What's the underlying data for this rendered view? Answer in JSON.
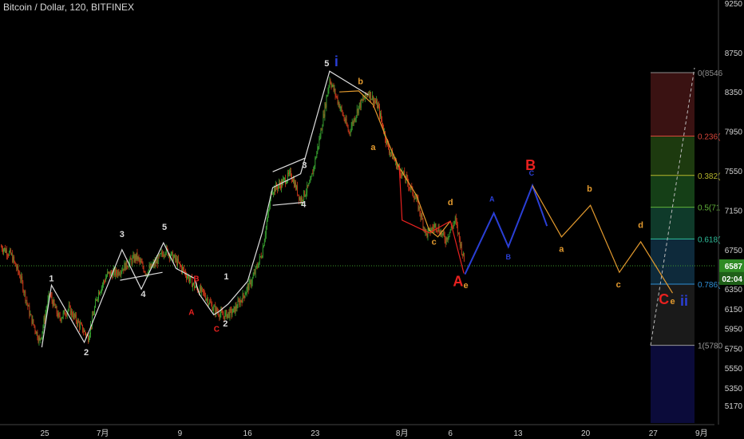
{
  "header": {
    "title": "Bitcoin / Dollar, 120, BITFINEX"
  },
  "colors": {
    "background": "#000000",
    "candle_up": "#3aa832",
    "candle_down": "#d03a1a",
    "wave_white": "#dddddd",
    "wave_orange": "#e39a2e",
    "wave_blue": "#2a3fd6",
    "wave_red": "#e8211f",
    "price_badge": "#2e8b24",
    "time_badge": "#1e5f18"
  },
  "chart_data": {
    "type": "candlestick",
    "symbol": "Bitcoin / Dollar",
    "interval": "120",
    "exchange": "BITFINEX",
    "y_axis": {
      "ticks": [
        9250,
        8750,
        8350,
        7950,
        7550,
        7150,
        6750,
        6350,
        6150,
        5950,
        5750,
        5550,
        5350,
        5170
      ],
      "range": [
        5050,
        9300
      ]
    },
    "x_axis": {
      "ticks": [
        {
          "label": "25",
          "day": 0
        },
        {
          "label": "7月",
          "day": 6
        },
        {
          "label": "9",
          "day": 14
        },
        {
          "label": "16",
          "day": 21
        },
        {
          "label": "23",
          "day": 28
        },
        {
          "label": "8月",
          "day": 37
        },
        {
          "label": "6",
          "day": 42
        },
        {
          "label": "13",
          "day": 49
        },
        {
          "label": "20",
          "day": 56
        },
        {
          "label": "27",
          "day": 63
        },
        {
          "label": "9月",
          "day": 68
        }
      ]
    },
    "current_price": {
      "value": 6587,
      "label": "6587",
      "countdown": "02:04"
    },
    "price_path": [
      [
        -4.5,
        6780
      ],
      [
        -3.5,
        6700
      ],
      [
        -2.5,
        6470
      ],
      [
        -1.5,
        6080
      ],
      [
        -0.5,
        5820
      ],
      [
        0.5,
        6300
      ],
      [
        1.5,
        6050
      ],
      [
        2.5,
        6150
      ],
      [
        3.5,
        6000
      ],
      [
        4.5,
        5860
      ],
      [
        5.5,
        6300
      ],
      [
        6.5,
        6500
      ],
      [
        7.5,
        6520
      ],
      [
        8.5,
        6600
      ],
      [
        9.5,
        6680
      ],
      [
        10.5,
        6520
      ],
      [
        11.5,
        6620
      ],
      [
        12.5,
        6750
      ],
      [
        13.5,
        6650
      ],
      [
        14.5,
        6520
      ],
      [
        15.5,
        6380
      ],
      [
        16.5,
        6300
      ],
      [
        17.5,
        6150
      ],
      [
        18.5,
        6080
      ],
      [
        19.5,
        6120
      ],
      [
        20.5,
        6270
      ],
      [
        21.5,
        6450
      ],
      [
        22.5,
        6720
      ],
      [
        23.5,
        7350
      ],
      [
        24.5,
        7420
      ],
      [
        25.5,
        7520
      ],
      [
        26.5,
        7250
      ],
      [
        27.5,
        7420
      ],
      [
        28.5,
        7900
      ],
      [
        29.5,
        8480
      ],
      [
        30.5,
        8220
      ],
      [
        31.5,
        7940
      ],
      [
        32.5,
        8200
      ],
      [
        33.5,
        8350
      ],
      [
        34.5,
        8200
      ],
      [
        35.5,
        7800
      ],
      [
        36.5,
        7600
      ],
      [
        37.5,
        7450
      ],
      [
        38.5,
        7250
      ],
      [
        39.5,
        6900
      ],
      [
        40.5,
        7000
      ],
      [
        41.5,
        6850
      ],
      [
        42.5,
        7050
      ],
      [
        43.5,
        6600
      ]
    ],
    "fibonacci": [
      {
        "ratio": "0(8546",
        "price": 8546,
        "color": "#8e8e8e",
        "fill": "#3a1212"
      },
      {
        "ratio": "0.236(",
        "price": 7902,
        "color": "#d9463a",
        "fill": "#1d3a0f"
      },
      {
        "ratio": "0.382(",
        "price": 7503,
        "color": "#b7b72c",
        "fill": "#153f17"
      },
      {
        "ratio": "0.5(71",
        "price": 7181,
        "color": "#62b33a",
        "fill": "#0f3a2a"
      },
      {
        "ratio": "0.618(",
        "price": 6859,
        "color": "#2fbf9c",
        "fill": "#0e2a3b"
      },
      {
        "ratio": "0.786(",
        "price": 6400,
        "color": "#2f8fd6",
        "fill": "#1a1a1a"
      },
      {
        "ratio": "1(5780",
        "price": 5780,
        "color": "#9a9a9a",
        "fill": "#0b0b3a"
      }
    ],
    "waves": [
      {
        "color": "white",
        "points": [
          [
            -0.3,
            5760
          ],
          [
            0.7,
            6390
          ],
          [
            4.1,
            5810
          ],
          [
            4.5,
            5900
          ],
          [
            8.0,
            6750
          ],
          [
            10.0,
            6350
          ],
          [
            12.3,
            6820
          ],
          [
            13.6,
            6560
          ],
          [
            15.5,
            6460
          ],
          [
            16.0,
            6300
          ],
          [
            17.5,
            6090
          ],
          [
            18.0,
            6120
          ],
          [
            19.0,
            6200
          ],
          [
            21.0,
            6430
          ],
          [
            22.5,
            6920
          ],
          [
            23.6,
            7380
          ],
          [
            26.5,
            7520
          ],
          [
            29.5,
            8560
          ],
          [
            33.5,
            8320
          ]
        ]
      },
      {
        "color": "white",
        "points": [
          [
            7.8,
            6440
          ],
          [
            12.2,
            6520
          ]
        ]
      },
      {
        "color": "white",
        "points": [
          [
            23.6,
            7540
          ],
          [
            27.0,
            7680
          ]
        ]
      },
      {
        "color": "white",
        "points": [
          [
            23.6,
            7200
          ],
          [
            26.8,
            7230
          ]
        ]
      },
      {
        "color": "orange",
        "points": [
          [
            30.5,
            8350
          ],
          [
            32.5,
            8360
          ],
          [
            34.0,
            8220
          ],
          [
            35.5,
            7850
          ],
          [
            36.6,
            7600
          ],
          [
            38.5,
            7300
          ],
          [
            39.8,
            6950
          ],
          [
            40.7,
            6880
          ],
          [
            42.0,
            7040
          ]
        ]
      },
      {
        "color": "blue",
        "points": [
          [
            43.5,
            6500
          ],
          [
            46.5,
            7120
          ],
          [
            48.0,
            6780
          ],
          [
            50.5,
            7400
          ],
          [
            52.0,
            6990
          ]
        ]
      },
      {
        "color": "orange",
        "points": [
          [
            50.5,
            7400
          ],
          [
            53.5,
            6880
          ],
          [
            56.5,
            7200
          ],
          [
            59.5,
            6520
          ],
          [
            61.7,
            6830
          ],
          [
            65.0,
            6310
          ]
        ]
      },
      {
        "color": "red",
        "points": [
          [
            36.7,
            7600
          ],
          [
            37.0,
            7050
          ],
          [
            39.8,
            6920
          ],
          [
            42.0,
            7040
          ],
          [
            43.4,
            6510
          ]
        ]
      }
    ],
    "labels": [
      {
        "text": "1",
        "day": 0.7,
        "price": 6430,
        "color": "white"
      },
      {
        "text": "2",
        "day": 4.3,
        "price": 5680,
        "color": "white"
      },
      {
        "text": "3",
        "day": 8.0,
        "price": 6880,
        "color": "white"
      },
      {
        "text": "4",
        "day": 10.2,
        "price": 6270,
        "color": "white"
      },
      {
        "text": "5",
        "day": 12.4,
        "price": 6950,
        "color": "white"
      },
      {
        "text": "B",
        "day": 15.7,
        "price": 6430,
        "color": "red"
      },
      {
        "text": "A",
        "day": 15.2,
        "price": 6090,
        "color": "red"
      },
      {
        "text": "C",
        "day": 17.8,
        "price": 5920,
        "color": "red"
      },
      {
        "text": "1",
        "day": 18.8,
        "price": 6450,
        "color": "white"
      },
      {
        "text": "2",
        "day": 18.7,
        "price": 5970,
        "color": "white"
      },
      {
        "text": "3",
        "day": 26.9,
        "price": 7580,
        "color": "white"
      },
      {
        "text": "4",
        "day": 26.8,
        "price": 7180,
        "color": "white"
      },
      {
        "text": "5",
        "day": 29.2,
        "price": 8610,
        "color": "white"
      },
      {
        "text": "i",
        "day": 30.2,
        "price": 8610,
        "color": "blue"
      },
      {
        "text": "b",
        "day": 32.7,
        "price": 8430,
        "color": "orange"
      },
      {
        "text": "a",
        "day": 34.0,
        "price": 7760,
        "color": "orange"
      },
      {
        "text": "c",
        "day": 40.3,
        "price": 6800,
        "color": "orange"
      },
      {
        "text": "d",
        "day": 42.0,
        "price": 7200,
        "color": "orange"
      },
      {
        "text": "A",
        "day": 42.8,
        "price": 6380,
        "color": "red"
      },
      {
        "text": "e",
        "day": 43.6,
        "price": 6360,
        "color": "orange"
      },
      {
        "text": "B",
        "day": 50.3,
        "price": 7560,
        "color": "red"
      },
      {
        "text": "C",
        "day": 50.4,
        "price": 7500,
        "color": "blue"
      },
      {
        "text": "A",
        "day": 46.3,
        "price": 7240,
        "color": "blue"
      },
      {
        "text": "B",
        "day": 48.0,
        "price": 6650,
        "color": "blue"
      },
      {
        "text": "a",
        "day": 53.5,
        "price": 6730,
        "color": "orange"
      },
      {
        "text": "b",
        "day": 56.4,
        "price": 7340,
        "color": "orange"
      },
      {
        "text": "c",
        "day": 59.4,
        "price": 6370,
        "color": "orange"
      },
      {
        "text": "d",
        "day": 61.7,
        "price": 6970,
        "color": "orange"
      },
      {
        "text": "C",
        "day": 64.1,
        "price": 6200,
        "color": "red"
      },
      {
        "text": "e",
        "day": 65.0,
        "price": 6200,
        "color": "orange"
      },
      {
        "text": "ii",
        "day": 66.2,
        "price": 6180,
        "color": "blue"
      }
    ]
  }
}
